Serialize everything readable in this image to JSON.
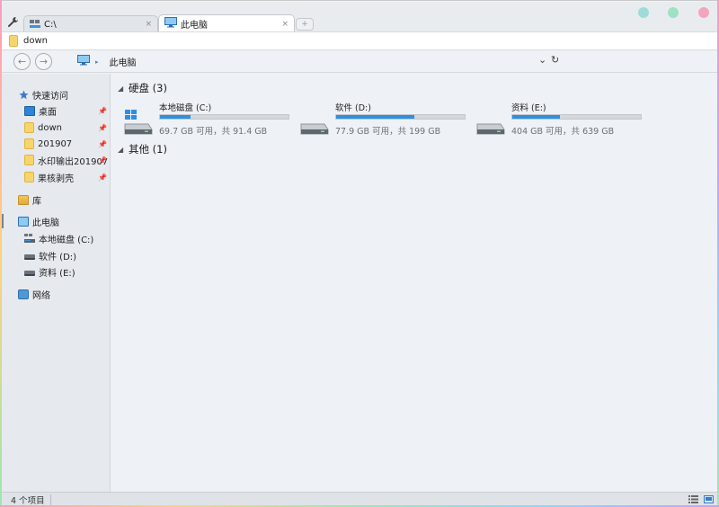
{
  "tabs": [
    {
      "label": "C:\\",
      "close": "×"
    },
    {
      "label": "此电脑",
      "close": "×"
    }
  ],
  "new_tab_glyph": "+",
  "window_dots": [
    {
      "name": "minimize-dot",
      "color": "#9fdcd8"
    },
    {
      "name": "maximize-dot",
      "color": "#9ee2c4"
    },
    {
      "name": "close-dot",
      "color": "#f3a5bd"
    }
  ],
  "path": {
    "current": "down"
  },
  "nav": {
    "back_glyph": "←",
    "forward_glyph": "→",
    "breadcrumb_sep": "▸",
    "breadcrumb": "此电脑",
    "dropdown_glyph": "⌄",
    "refresh_glyph": "↻"
  },
  "sidebar": {
    "pin_glyph": "📌",
    "quick_access": "快速访问",
    "quick_items": [
      {
        "label": "桌面",
        "icon": "desktop-icon"
      },
      {
        "label": "down",
        "icon": "folder-icon"
      },
      {
        "label": "201907",
        "icon": "folder-icon"
      },
      {
        "label": "水印输出201907",
        "icon": "folder-icon"
      },
      {
        "label": "果核剥壳",
        "icon": "folder-icon"
      }
    ],
    "library": "库",
    "this_pc": "此电脑",
    "drives": [
      {
        "label": "本地磁盘 (C:)"
      },
      {
        "label": "软件 (D:)"
      },
      {
        "label": "资料 (E:)"
      }
    ],
    "network": "网络"
  },
  "main": {
    "groups": [
      {
        "label": "硬盘 (3)",
        "expanded_glyph": "◢"
      },
      {
        "label": "其他 (1)",
        "expanded_glyph": "◢"
      }
    ],
    "drives": [
      {
        "name": "本地磁盘 (C:)",
        "info": "69.7 GB 可用，共 91.4 GB",
        "used_fraction": 0.24
      },
      {
        "name": "软件 (D:)",
        "info": "77.9 GB 可用，共 199 GB",
        "used_fraction": 0.61
      },
      {
        "name": "资料 (E:)",
        "info": "404 GB 可用，共 639 GB",
        "used_fraction": 0.37
      }
    ]
  },
  "status": {
    "items_count": "4 个项目"
  },
  "colors": {
    "accent": "#2f8fe0",
    "sidebar_bg": "#e6e9ee",
    "main_bg": "#eef1f5"
  }
}
